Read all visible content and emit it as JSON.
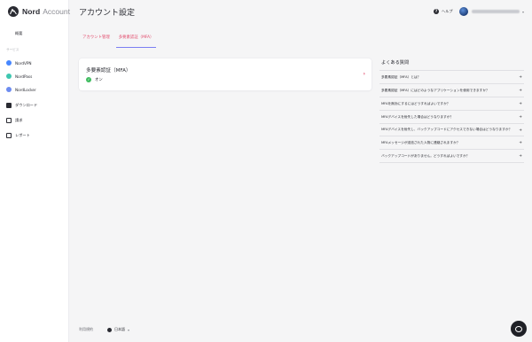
{
  "brand": {
    "name": "Nord",
    "sub": "Account"
  },
  "sidebar": {
    "items": [
      {
        "label": "概要",
        "icon": "dashboard-grid-icon"
      },
      {
        "label": "NordVPN",
        "icon": "nordvpn-icon",
        "color": "#4687ff"
      },
      {
        "label": "NordPass",
        "icon": "nordpass-icon",
        "color": "#3ec7b0"
      },
      {
        "label": "NordLocker",
        "icon": "nordlocker-icon",
        "color": "#6d8cf0"
      },
      {
        "label": "ダウンロード",
        "icon": "download-icon"
      },
      {
        "label": "請求",
        "icon": "billing-icon"
      },
      {
        "label": "レポート",
        "icon": "report-icon"
      }
    ],
    "section_label": "サービス"
  },
  "header": {
    "title": "アカウント設定",
    "help_label": "ヘルプ",
    "user_email": "[email redacted]"
  },
  "tabs": [
    {
      "label": "アカウント管理",
      "active": false
    },
    {
      "label": "多要素認証（MFA）",
      "active": true
    }
  ],
  "mfa_card": {
    "title": "多要素認証（MFA）",
    "status": "オン",
    "status_color": "#3fbc5f"
  },
  "faq": {
    "title": "よくある質問",
    "items": [
      "多要素認証（MFA）とは？",
      "多要素認証（MFA）にはどのようなアプリケーションを使用できますか？",
      "MFAを無効にするにはどうすればよいですか？",
      "MFAデバイスを紛失した場合はどうなりますか？",
      "MFAデバイスを紛失し、バックアップコードにアクセスできない場合はどうなりますか？",
      "MFAメッセージが送信された人物に連絡されますか？",
      "バックアップコードがありません。どうすればよいですか？"
    ]
  },
  "footer": {
    "terms_label": "利用規約",
    "language_label": "日本語"
  },
  "colors": {
    "accent": "#e24d6e",
    "tab_underline": "#7b7ff2",
    "text": "#2a2b32",
    "background": "#f5f5f6"
  }
}
